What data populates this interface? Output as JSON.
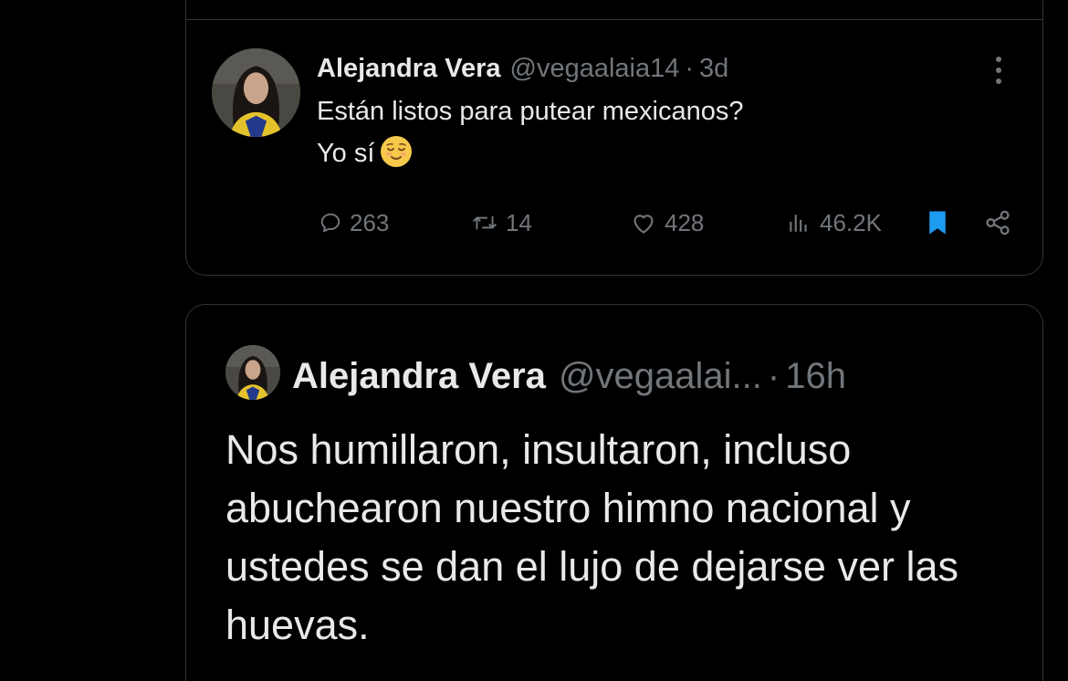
{
  "tweet_top": {
    "author_name": "Alejandra Vera",
    "handle": "@vegaalaia14",
    "separator": "·",
    "time": "3d",
    "text_line1": "Están listos para putear mexicanos?",
    "text_line2": "Yo sí",
    "emoji": "relieved-face",
    "replies": "263",
    "retweets": "14",
    "likes": "428",
    "views": "46.2K",
    "bookmarked": true,
    "accent_color": "#1d9bf0"
  },
  "tweet_quoted": {
    "author_name": "Alejandra Vera",
    "handle": "@vegaalai...",
    "separator": "·",
    "time": "16h",
    "text": "Nos humillaron, insultaron, incluso abuchearon nuestro himno nacional y ustedes se dan el lujo de dejarse ver las huevas."
  },
  "icons": [
    "more-icon",
    "reply-icon",
    "retweet-icon",
    "like-icon",
    "views-icon",
    "bookmark-icon",
    "share-icon"
  ]
}
